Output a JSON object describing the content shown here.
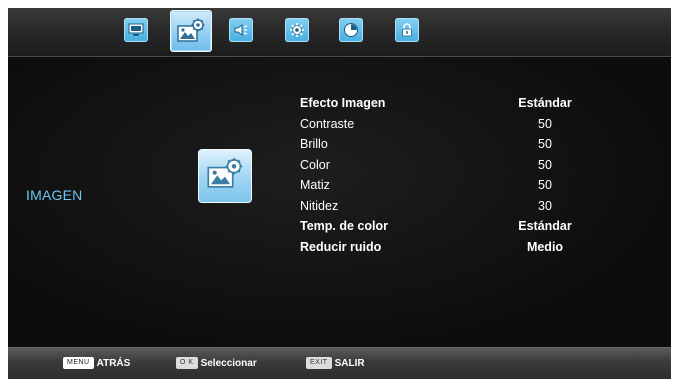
{
  "colors": {
    "accent": "#45aee2",
    "section_title": "#6ec6f4",
    "text": "#ffffff"
  },
  "tabs": [
    {
      "icon": "tv-icon",
      "active": false
    },
    {
      "icon": "picture-settings-icon",
      "active": true
    },
    {
      "icon": "speaker-icon",
      "active": false
    },
    {
      "icon": "gear-icon",
      "active": false
    },
    {
      "icon": "clock-icon",
      "active": false
    },
    {
      "icon": "lock-icon",
      "active": false
    }
  ],
  "section": {
    "title": "IMAGEN",
    "icon": "picture-settings-icon"
  },
  "menu": {
    "items": [
      {
        "label": "Efecto Imagen",
        "value": "Estándar",
        "bold": true
      },
      {
        "label": "Contraste",
        "value": "50",
        "bold": false
      },
      {
        "label": "Brillo",
        "value": "50",
        "bold": false
      },
      {
        "label": "Color",
        "value": "50",
        "bold": false
      },
      {
        "label": "Matiz",
        "value": "50",
        "bold": false
      },
      {
        "label": "Nitidez",
        "value": "30",
        "bold": false
      },
      {
        "label": "Temp. de color",
        "value": "Estándar",
        "bold": true
      },
      {
        "label": "Reducir ruido",
        "value": "Medio",
        "bold": true
      }
    ]
  },
  "footer": {
    "back": {
      "key": "MENU",
      "label": "ATRÁS"
    },
    "select": {
      "key": "O K",
      "label": "Seleccionar"
    },
    "exit": {
      "key": "EXIT",
      "label": "SALIR"
    }
  }
}
